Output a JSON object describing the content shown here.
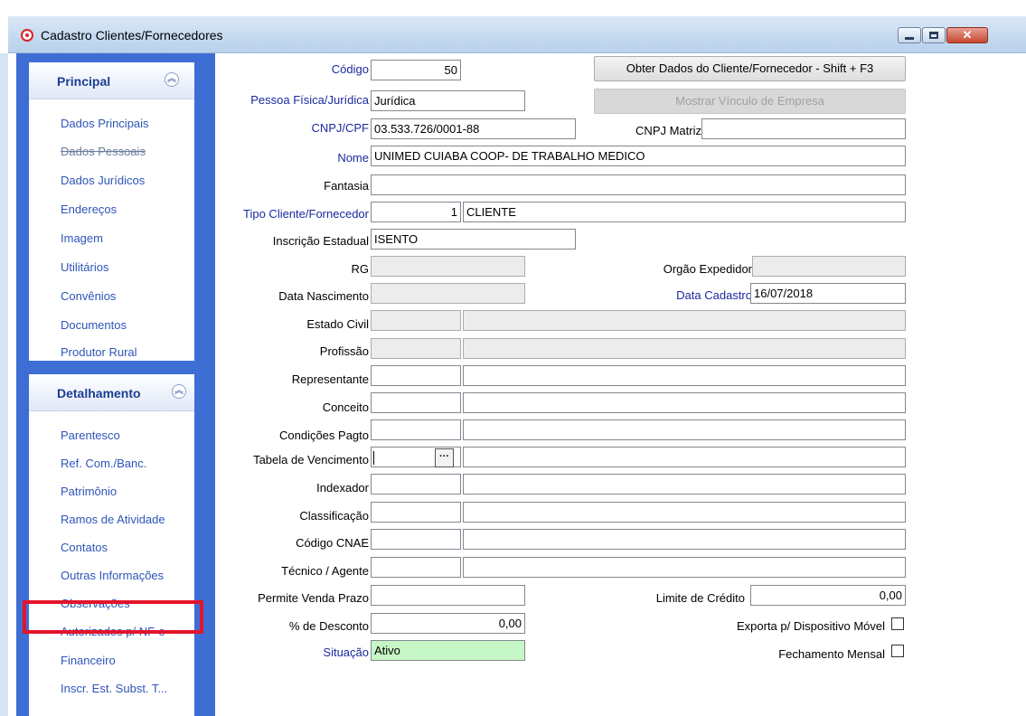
{
  "window": {
    "title": "Cadastro Clientes/Fornecedores",
    "close_glyph": "✕"
  },
  "sidebar": {
    "principal": {
      "title": "Principal",
      "items": [
        "Dados Principais",
        "Dados Pessoais",
        "Dados Jurídicos",
        "Endereços",
        "Imagem",
        "Utilitários",
        "Convênios",
        "Documentos",
        "Produtor Rural"
      ]
    },
    "detalhamento": {
      "title": "Detalhamento",
      "items": [
        "Parentesco",
        "Ref. Com./Banc.",
        "Patrimônio",
        "Ramos de Atividade",
        "Contatos",
        "Outras Informações",
        "Observações",
        "Autorizados p/ NF-e",
        "Financeiro",
        "Inscr. Est. Subst. T..."
      ]
    },
    "chevron_glyph": "︽"
  },
  "buttons": {
    "obter": "Obter Dados do Cliente/Fornecedor - Shift + F3",
    "mostrar": "Mostrar Vínculo de Empresa",
    "ellipsis": "···"
  },
  "form": {
    "codigo": {
      "label": "Código",
      "value": "50"
    },
    "pessoa": {
      "label": "Pessoa Física/Jurídica",
      "value": "Jurídica"
    },
    "cnpj": {
      "label": "CNPJ/CPF",
      "value": "03.533.726/0001-88"
    },
    "cnpj_matriz": {
      "label": "CNPJ Matriz",
      "value": ""
    },
    "nome": {
      "label": "Nome",
      "value": "UNIMED CUIABA COOP- DE TRABALHO MEDICO"
    },
    "fantasia": {
      "label": "Fantasia",
      "value": ""
    },
    "tipo": {
      "label": "Tipo Cliente/Fornecedor",
      "code": "1",
      "desc": "CLIENTE"
    },
    "inscricao": {
      "label": "Inscrição Estadual",
      "value": "ISENTO"
    },
    "rg": {
      "label": "RG",
      "value": ""
    },
    "orgao": {
      "label": "Orgão Expedidor",
      "value": ""
    },
    "nascimento": {
      "label": "Data Nascimento",
      "value": ""
    },
    "cadastro": {
      "label": "Data Cadastro",
      "value": "16/07/2018"
    },
    "estado_civil": {
      "label": "Estado Civil"
    },
    "profissao": {
      "label": "Profissão"
    },
    "representante": {
      "label": "Representante"
    },
    "conceito": {
      "label": "Conceito"
    },
    "condicoes": {
      "label": "Condições Pagto"
    },
    "tabela": {
      "label": "Tabela de Vencimento"
    },
    "indexador": {
      "label": "Indexador"
    },
    "classificacao": {
      "label": "Classificação"
    },
    "cnae": {
      "label": "Código CNAE"
    },
    "tecnico": {
      "label": "Técnico / Agente"
    },
    "permite": {
      "label": "Permite Venda  Prazo",
      "value": ""
    },
    "limite": {
      "label": "Limite de Crédito",
      "value": "0,00"
    },
    "desconto": {
      "label": "% de Desconto",
      "value": "0,00"
    },
    "exporta": {
      "label": "Exporta p/ Dispositivo Móvel",
      "checked": false
    },
    "situacao": {
      "label": "Situação",
      "value": "Ativo"
    },
    "fechamento": {
      "label": "Fechamento Mensal",
      "checked": false
    }
  }
}
